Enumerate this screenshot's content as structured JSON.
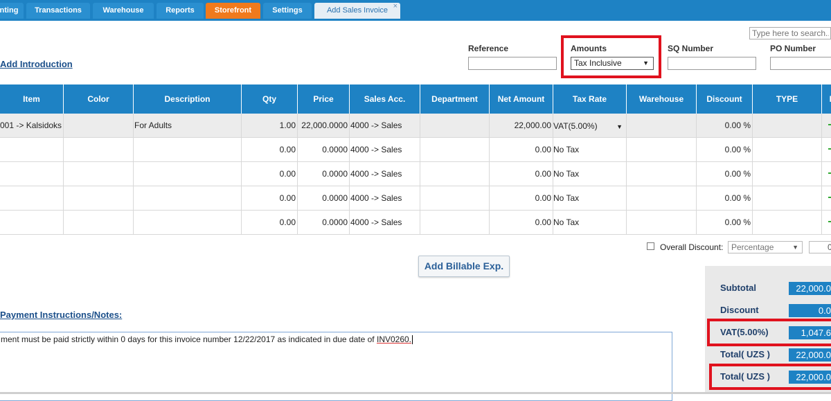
{
  "tabs": [
    {
      "label": "nting"
    },
    {
      "label": "Transactions"
    },
    {
      "label": "Warehouse"
    },
    {
      "label": "Reports"
    },
    {
      "label": "Storefront"
    },
    {
      "label": "Settings"
    },
    {
      "label": "Add Sales Invoice",
      "close": "×"
    }
  ],
  "search": {
    "placeholder": "Type here to search..."
  },
  "header": {
    "add_introduction": "Add Introduction",
    "reference_label": "Reference",
    "reference_value": "",
    "amounts_label": "Amounts",
    "amounts_value": "Tax Inclusive",
    "sq_label": "SQ Number",
    "sq_value": "",
    "po_label": "PO Number",
    "po_value": ""
  },
  "table": {
    "columns": [
      "Item",
      "Color",
      "Description",
      "Qty",
      "Price",
      "Sales Acc.",
      "Department",
      "Net Amount",
      "Tax Rate",
      "Warehouse",
      "Discount",
      "TYPE",
      "D"
    ],
    "rows": [
      {
        "item": "001 -> Kalsidoks",
        "color": "",
        "description": "For Adults",
        "qty": "1.00",
        "price": "22,000.0000",
        "sales_acc": "4000 -> Sales",
        "department": "",
        "net": "22,000.00",
        "tax": "VAT(5.00%)",
        "warehouse": "",
        "discount": "0.00 %",
        "type": ""
      },
      {
        "item": "",
        "color": "",
        "description": "",
        "qty": "0.00",
        "price": "0.0000",
        "sales_acc": "4000 -> Sales",
        "department": "",
        "net": "0.00",
        "tax": "No Tax",
        "warehouse": "",
        "discount": "0.00 %",
        "type": ""
      },
      {
        "item": "",
        "color": "",
        "description": "",
        "qty": "0.00",
        "price": "0.0000",
        "sales_acc": "4000 -> Sales",
        "department": "",
        "net": "0.00",
        "tax": "No Tax",
        "warehouse": "",
        "discount": "0.00 %",
        "type": ""
      },
      {
        "item": "",
        "color": "",
        "description": "",
        "qty": "0.00",
        "price": "0.0000",
        "sales_acc": "4000 -> Sales",
        "department": "",
        "net": "0.00",
        "tax": "No Tax",
        "warehouse": "",
        "discount": "0.00 %",
        "type": ""
      },
      {
        "item": "",
        "color": "",
        "description": "",
        "qty": "0.00",
        "price": "0.0000",
        "sales_acc": "4000 -> Sales",
        "department": "",
        "net": "0.00",
        "tax": "No Tax",
        "warehouse": "",
        "discount": "0.00 %",
        "type": ""
      }
    ]
  },
  "overall_discount": {
    "label": "Overall Discount:",
    "type": "Percentage",
    "value": "0"
  },
  "add_billable": "Add Billable Exp.",
  "payment": {
    "header": "Payment Instructions/Notes:",
    "text_before": "ment must be paid strictly within 0 days for this invoice number 12/22/2017 as indicated in due date of ",
    "text_link": "INV0260."
  },
  "totals": {
    "subtotal_label": "Subtotal",
    "subtotal_value": "22,000.0",
    "discount_label": "Discount",
    "discount_value": "0.0",
    "vat_label": "VAT(5.00%)",
    "vat_value": "1,047.6",
    "total1_label": "Total( UZS )",
    "total1_value": "22,000.0",
    "total2_label": "Total( UZS )",
    "total2_value": "22,000.0"
  },
  "colors": {
    "tab_bar": "#1e82c4",
    "storefront_tab": "#f07a1d",
    "highlight": "#e0121e"
  }
}
